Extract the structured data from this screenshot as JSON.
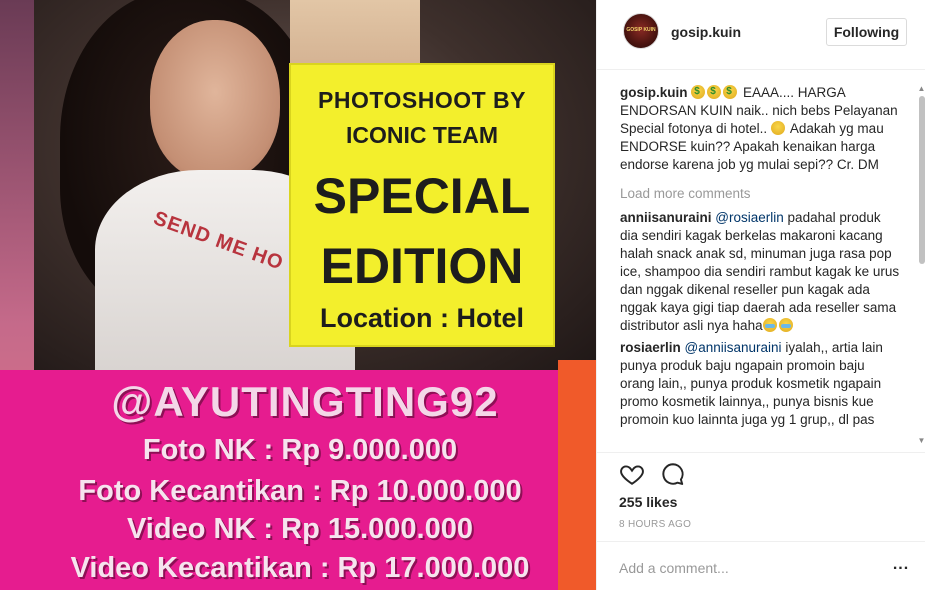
{
  "post": {
    "image": {
      "headline": {
        "line1": "PHOTOSHOOT BY",
        "line2": "ICONIC TEAM",
        "line3": "SPECIAL",
        "line4": "EDITION",
        "line5": "Location : Hotel"
      },
      "shirt_text": "SEND ME HO",
      "handle": "@AYUTINGTING92",
      "prices": [
        "Foto NK : Rp  9.000.000",
        "Foto Kecantikan : Rp 10.000.000",
        "Video NK : Rp 15.000.000",
        "Video Kecantikan : Rp 17.000.000"
      ]
    }
  },
  "header": {
    "avatar_text": "GOSIP KUIN",
    "username": "gosip.kuin",
    "follow_label": "Following"
  },
  "caption": {
    "author": "gosip.kuin",
    "text": "EAAA.... HARGA ENDORSAN KUIN naik.. nich bebs Pelayanan Special fotonya di hotel..",
    "text2": "Adakah yg mau ENDORSE kuin?? Apakah kenaikan harga endorse karena job yg mulai sepi?? Cr. DM"
  },
  "load_more_label": "Load more comments",
  "comments": [
    {
      "author": "anniisanuraini",
      "mention": "@rosiaerlin",
      "text": "padahal produk dia sendiri kagak berkelas makaroni kacang halah snack anak sd, minuman juga rasa pop ice, shampoo dia sendiri rambut kagak ke urus dan nggak dikenal reseller pun kagak ada nggak kaya gigi tiap daerah ada reseller sama distributor asli nya haha"
    },
    {
      "author": "rosiaerlin",
      "mention": "@anniisanuraini",
      "text": "iyalah,, artia lain punya produk baju ngapain promoin baju orang lain,, punya produk kosmetik ngapain promo kosmetik lainnya,, punya bisnis kue promoin kuo lainnta juga yg 1 grup,, dl pas"
    }
  ],
  "actions": {
    "likes": "255 likes",
    "time_ago": "8 HOURS AGO",
    "add_comment_placeholder": "Add a comment...",
    "more_label": "..."
  },
  "colors": {
    "pink": "#e61c8f",
    "yellow": "#f3ef2c",
    "link": "#003569"
  }
}
